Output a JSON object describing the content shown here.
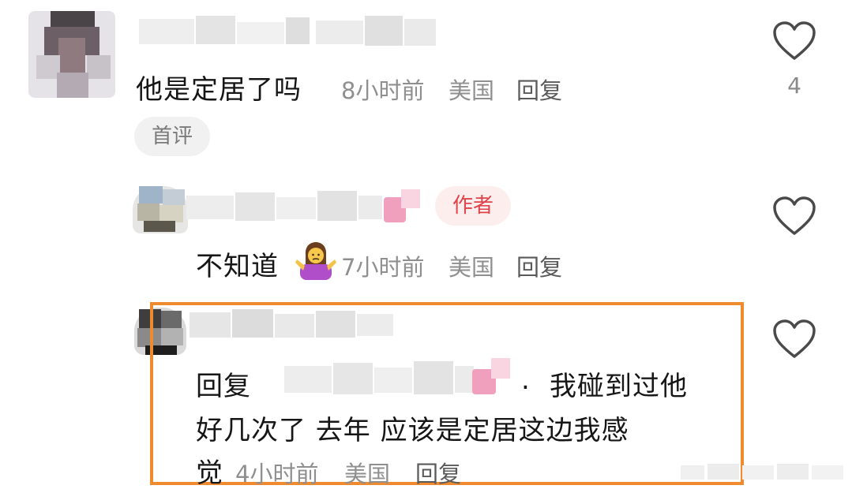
{
  "comments": [
    {
      "text": "他是定居了吗",
      "time": "8小时前",
      "location": "美国",
      "reply_label": "回复",
      "badge": "首评",
      "likes": "4"
    },
    {
      "text": "不知道",
      "emoji": "woman-shrugging",
      "time": "7小时前",
      "location": "美国",
      "reply_label": "回复",
      "badge": "作者"
    },
    {
      "reply_prefix": "回复",
      "separator": ".",
      "text_line1": "我碰到过他",
      "text_line2": "好几次了 去年 应该是定居这边我感",
      "text_line3": "觉",
      "time": "4小时前",
      "location": "美国",
      "reply_label": "回复"
    }
  ],
  "colors": {
    "highlight_border": "#f08a2e",
    "author_badge_text": "#e0444a",
    "author_badge_bg": "#fdeeee"
  },
  "icons": [
    "heart-outline-icon"
  ]
}
